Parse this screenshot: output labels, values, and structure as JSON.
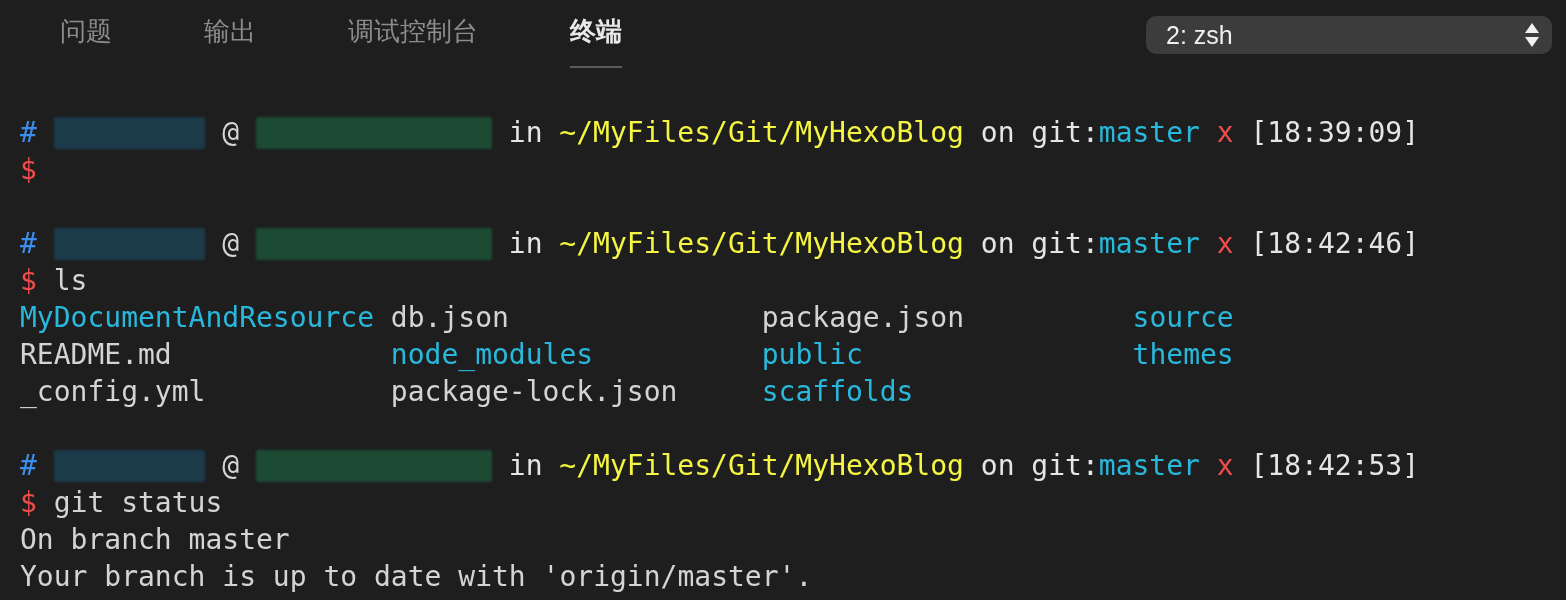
{
  "tabs": [
    {
      "label": "问题",
      "selected": false
    },
    {
      "label": "输出",
      "selected": false
    },
    {
      "label": "调试控制台",
      "selected": false
    },
    {
      "label": "终端",
      "selected": true
    }
  ],
  "terminal_selector": {
    "value": "2: zsh"
  },
  "blocks": [
    {
      "prompt": {
        "hash": "#",
        "at": "@",
        "in": "in",
        "path": "~/MyFiles/Git/MyHexoBlog",
        "on": "on",
        "git_label": "git:",
        "branch": "master",
        "dirty_mark": "x",
        "time": "[18:39:09]"
      },
      "command": {
        "symbol": "$"
      }
    },
    {
      "prompt": {
        "hash": "#",
        "at": "@",
        "in": "in",
        "path": "~/MyFiles/Git/MyHexoBlog",
        "on": "on",
        "git_label": "git:",
        "branch": "master",
        "dirty_mark": "x",
        "time": "[18:42:46]"
      },
      "command": {
        "symbol": "$",
        "text": "ls"
      },
      "listing": [
        {
          "name": "MyDocumentAndResource",
          "kind": "dir"
        },
        {
          "name": "db.json",
          "kind": "file"
        },
        {
          "name": "package.json",
          "kind": "file"
        },
        {
          "name": "source",
          "kind": "dir"
        },
        {
          "name": "README.md",
          "kind": "file"
        },
        {
          "name": "node_modules",
          "kind": "dir"
        },
        {
          "name": "public",
          "kind": "dir"
        },
        {
          "name": "themes",
          "kind": "dir"
        },
        {
          "name": "_config.yml",
          "kind": "file"
        },
        {
          "name": "package-lock.json",
          "kind": "file"
        },
        {
          "name": "scaffolds",
          "kind": "dir"
        }
      ]
    },
    {
      "prompt": {
        "hash": "#",
        "at": "@",
        "in": "in",
        "path": "~/MyFiles/Git/MyHexoBlog",
        "on": "on",
        "git_label": "git:",
        "branch": "master",
        "dirty_mark": "x",
        "time": "[18:42:53]"
      },
      "command": {
        "symbol": "$",
        "text": "git status"
      },
      "lines": [
        "On branch master",
        "Your branch is up to date with 'origin/master'."
      ]
    }
  ]
}
